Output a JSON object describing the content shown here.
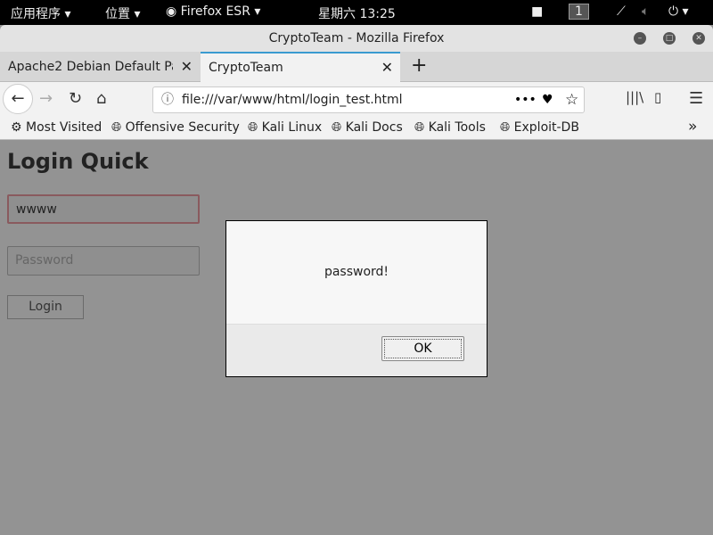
{
  "topbar": {
    "apps": "应用程序",
    "places": "位置",
    "app": "Firefox ESR",
    "clock": "星期六 13:25",
    "workspace": "1"
  },
  "window": {
    "title": "CryptoTeam - Mozilla Firefox"
  },
  "tabs": [
    {
      "label": "Apache2 Debian Default Page",
      "active": false
    },
    {
      "label": "CryptoTeam",
      "active": true
    }
  ],
  "accent": "#3a9bd0",
  "url": "file:///var/www/html/login_test.html",
  "bookmarks": [
    "Most Visited",
    "Offensive Security",
    "Kali Linux",
    "Kali Docs",
    "Kali Tools",
    "Exploit-DB"
  ],
  "page": {
    "heading": "Login Quick",
    "username_value": "wwww",
    "password_placeholder": "Password",
    "login_label": "Login"
  },
  "dialog": {
    "message": "password!",
    "ok_label": "OK"
  }
}
